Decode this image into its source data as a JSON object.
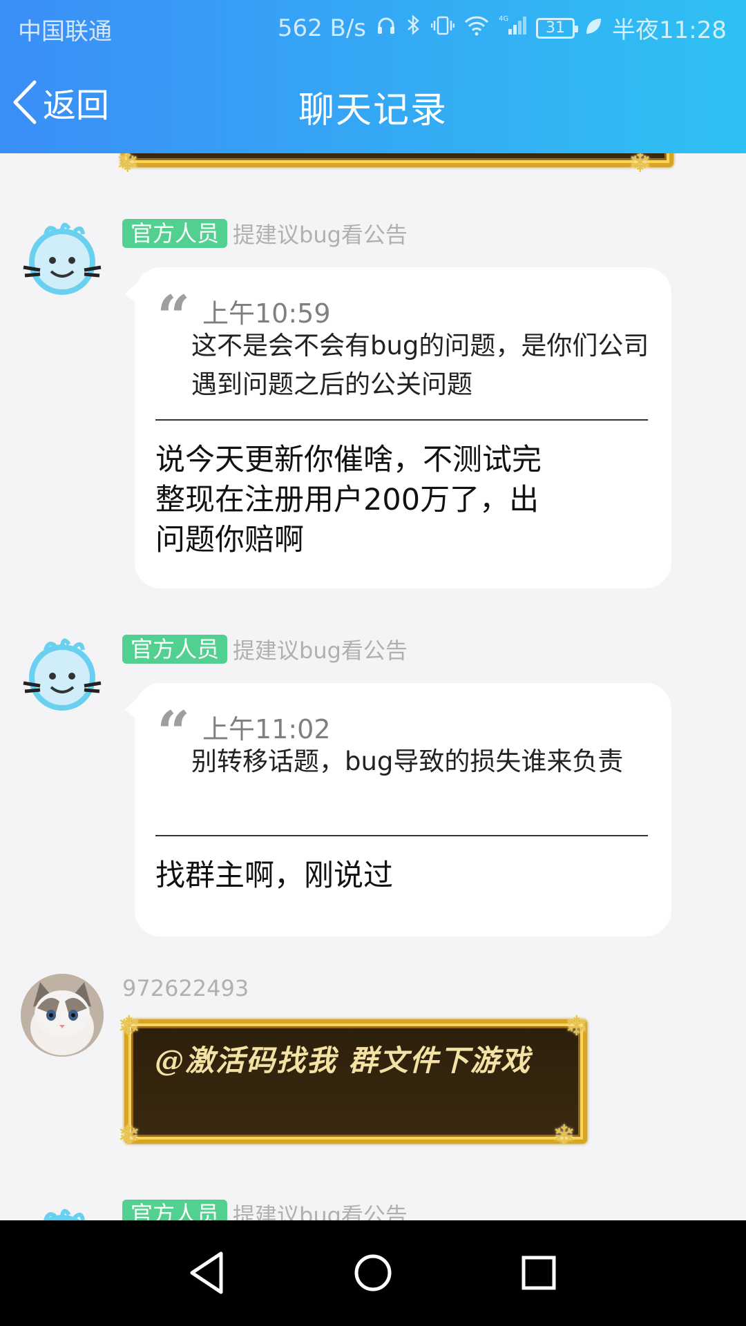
{
  "statusbar": {
    "carrier": "中国联通",
    "speed": "562 B/s",
    "battery": "31",
    "time": "半夜11:28"
  },
  "navbar": {
    "back_label": "返回",
    "title": "聊天记录"
  },
  "messages": [
    {
      "badge": "官方人员",
      "nickname": "提建议bug看公告",
      "quote_time": "上午10:59",
      "quote_text": "这不是会不会有bug的问题，是你们公司遇到问题之后的公关问题",
      "reply": "说今天更新你催啥，不测试完整现在注册用户200万了，出问题你赔啊"
    },
    {
      "badge": "官方人员",
      "nickname": "提建议bug看公告",
      "quote_time": "上午11:02",
      "quote_text": "别转移话题，bug导致的损失谁来负责",
      "reply": "找群主啊，刚说过"
    },
    {
      "nickname": "972622493",
      "banner_text": "@激活码找我 群文件下游戏"
    },
    {
      "badge": "官方人员",
      "nickname": "提建议bug看公告"
    }
  ],
  "colors": {
    "header_start": "#3a8ef6",
    "header_end": "#2fc1f3",
    "badge": "#52d08f",
    "gold": "#d9a520"
  }
}
